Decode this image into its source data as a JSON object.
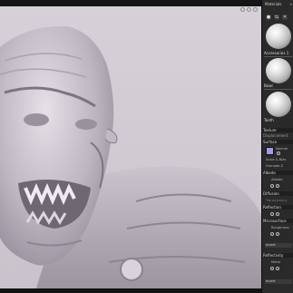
{
  "viewport": {
    "bg": "#d3cdd5"
  },
  "panel": {
    "title": "Materials",
    "close": "x",
    "toolbar": [
      "●",
      "⇆",
      "✕"
    ],
    "materials": [
      {
        "label": "Accessories 1"
      },
      {
        "label": "Bowl"
      },
      {
        "label": "Teeth"
      }
    ],
    "sections": {
      "texture": "Texture",
      "displacement": "Displacement",
      "surface": "Surface",
      "normal": "Normal",
      "scale_bias": "Scale & Bias",
      "grenade": "Grenade Z",
      "albedo": "Albedo",
      "albedo_sub": "Albedo",
      "diffusion": "Diffusion",
      "translucency": "Translucency",
      "reflection": "Reflection",
      "microsurface": "Microsurface",
      "roughness": "Roughness",
      "invert": "Invert",
      "reflectivity": "Reflectivity",
      "metal": "Metal",
      "invert2": "Invert"
    }
  }
}
